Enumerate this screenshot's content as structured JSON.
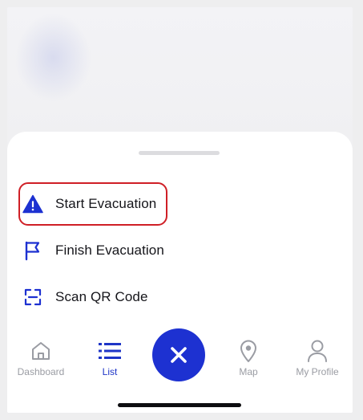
{
  "menu": {
    "items": [
      {
        "label": "Start Evacuation",
        "icon": "warning-triangle-icon"
      },
      {
        "label": "Finish Evacuation",
        "icon": "flag-icon"
      },
      {
        "label": "Scan QR Code",
        "icon": "qr-scan-icon"
      }
    ],
    "highlighted_item": "Start Evacuation"
  },
  "tabbar": {
    "tabs": [
      {
        "label": "Dashboard",
        "icon": "home-icon",
        "active": false
      },
      {
        "label": "List",
        "icon": "list-icon",
        "active": true
      },
      {
        "label": "Map",
        "icon": "location-pin-icon",
        "active": false
      },
      {
        "label": "My Profile",
        "icon": "person-icon",
        "active": false
      }
    ],
    "center_button_icon": "close-icon"
  },
  "colors": {
    "accent": "#1d31d1",
    "active_tab": "#1e35c7",
    "inactive_tab": "#9a9ca3",
    "highlight_border": "#cf1f26",
    "text": "#15151a"
  }
}
